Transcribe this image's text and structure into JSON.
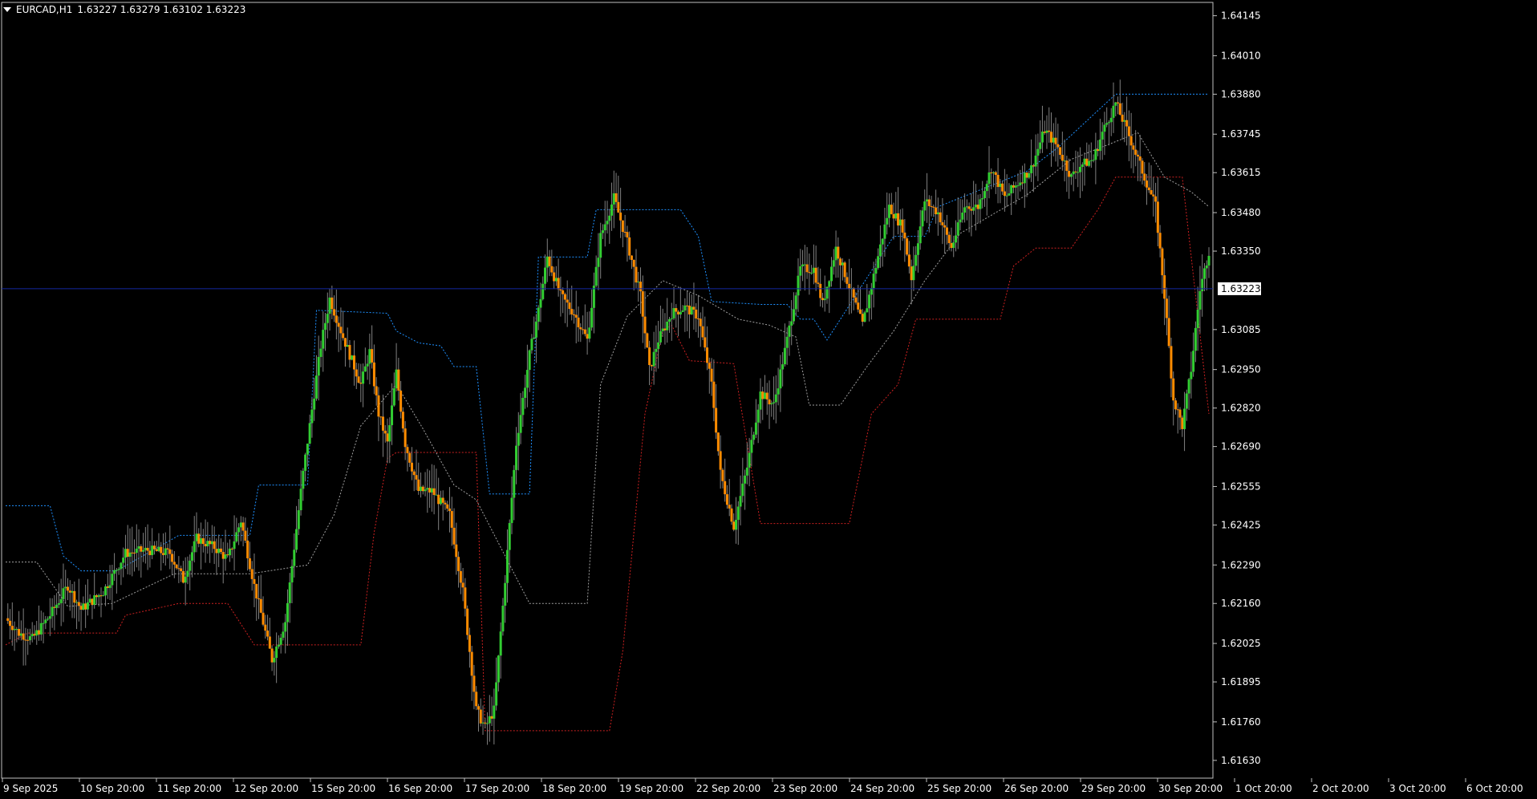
{
  "header": {
    "symbol": "EURCAD,H1",
    "ohlc": "1.63227 1.63279 1.63102 1.63223"
  },
  "colors": {
    "background": "#000000",
    "frame": "#c0c0c0",
    "text": "#ffffff",
    "bull": "#32cd32",
    "bear": "#ff8c00",
    "wick": "#808080",
    "upper_band": "#1e90ff",
    "lower_band": "#cc2020",
    "mid_band": "#a0a0a0",
    "price_line": "#1428a0"
  },
  "chart_data": {
    "type": "line",
    "title": "EURCAD,H1",
    "current_price": 1.63223,
    "current_price_label": "1.63223",
    "ylim": [
      1.6157,
      1.6419
    ],
    "y_ticks": [
      "1.64145",
      "1.64010",
      "1.63880",
      "1.63745",
      "1.63615",
      "1.63480",
      "1.63350",
      "1.63223",
      "1.63085",
      "1.62950",
      "1.62820",
      "1.62690",
      "1.62555",
      "1.62425",
      "1.62290",
      "1.62160",
      "1.62025",
      "1.61895",
      "1.61760",
      "1.61630"
    ],
    "x_ticks": [
      "9 Sep 2025",
      "10 Sep 20:00",
      "11 Sep 20:00",
      "12 Sep 20:00",
      "15 Sep 20:00",
      "16 Sep 20:00",
      "17 Sep 20:00",
      "18 Sep 20:00",
      "19 Sep 20:00",
      "22 Sep 20:00",
      "23 Sep 20:00",
      "24 Sep 20:00",
      "25 Sep 20:00",
      "26 Sep 20:00",
      "29 Sep 20:00",
      "30 Sep 20:00",
      "1 Oct 20:00",
      "2 Oct 20:00",
      "3 Oct 20:00",
      "6 Oct 20:00"
    ],
    "grid": false,
    "series": [
      {
        "values": [
          [
            0,
            1.6211
          ],
          [
            6,
            1.6206
          ],
          [
            12,
            1.6204
          ],
          [
            20,
            1.6212
          ],
          [
            28,
            1.6222
          ],
          [
            34,
            1.6214
          ],
          [
            44,
            1.622
          ],
          [
            54,
            1.6233
          ],
          [
            64,
            1.6234
          ],
          [
            74,
            1.6233
          ],
          [
            80,
            1.6224
          ],
          [
            86,
            1.6238
          ],
          [
            94,
            1.6235
          ],
          [
            100,
            1.6231
          ],
          [
            106,
            1.6244
          ],
          [
            112,
            1.6222
          ],
          [
            120,
            1.6197
          ],
          [
            126,
            1.621
          ],
          [
            134,
            1.626
          ],
          [
            142,
            1.6303
          ],
          [
            146,
            1.6319
          ],
          [
            152,
            1.6306
          ],
          [
            160,
            1.629
          ],
          [
            164,
            1.6301
          ],
          [
            168,
            1.628
          ],
          [
            172,
            1.627
          ],
          [
            176,
            1.6294
          ],
          [
            180,
            1.627
          ],
          [
            186,
            1.6254
          ],
          [
            192,
            1.6254
          ],
          [
            200,
            1.6246
          ],
          [
            206,
            1.622
          ],
          [
            212,
            1.618
          ],
          [
            216,
            1.6174
          ],
          [
            220,
            1.618
          ],
          [
            224,
            1.6215
          ],
          [
            230,
            1.627
          ],
          [
            236,
            1.63
          ],
          [
            240,
            1.6315
          ],
          [
            244,
            1.6333
          ],
          [
            250,
            1.632
          ],
          [
            256,
            1.6314
          ],
          [
            262,
            1.6305
          ],
          [
            268,
            1.634
          ],
          [
            274,
            1.6353
          ],
          [
            280,
            1.6338
          ],
          [
            286,
            1.632
          ],
          [
            290,
            1.6295
          ],
          [
            294,
            1.6305
          ],
          [
            300,
            1.6314
          ],
          [
            306,
            1.6316
          ],
          [
            312,
            1.6313
          ],
          [
            318,
            1.629
          ],
          [
            322,
            1.626
          ],
          [
            328,
            1.6242
          ],
          [
            334,
            1.6262
          ],
          [
            340,
            1.6287
          ],
          [
            346,
            1.6283
          ],
          [
            352,
            1.6305
          ],
          [
            358,
            1.6329
          ],
          [
            364,
            1.6329
          ],
          [
            368,
            1.6317
          ],
          [
            374,
            1.6336
          ],
          [
            380,
            1.6323
          ],
          [
            386,
            1.631
          ],
          [
            392,
            1.633
          ],
          [
            398,
            1.635
          ],
          [
            404,
            1.6343
          ],
          [
            408,
            1.6326
          ],
          [
            414,
            1.6352
          ],
          [
            420,
            1.6348
          ],
          [
            426,
            1.6336
          ],
          [
            432,
            1.635
          ],
          [
            438,
            1.635
          ],
          [
            444,
            1.6363
          ],
          [
            450,
            1.6353
          ],
          [
            456,
            1.6358
          ],
          [
            462,
            1.6363
          ],
          [
            468,
            1.6376
          ],
          [
            474,
            1.637
          ],
          [
            480,
            1.636
          ],
          [
            484,
            1.6364
          ],
          [
            490,
            1.6366
          ],
          [
            494,
            1.6375
          ],
          [
            500,
            1.6385
          ],
          [
            506,
            1.6374
          ],
          [
            512,
            1.6362
          ],
          [
            518,
            1.635
          ],
          [
            522,
            1.632
          ],
          [
            526,
            1.6285
          ],
          [
            530,
            1.6276
          ],
          [
            534,
            1.6295
          ],
          [
            538,
            1.6322
          ],
          [
            542,
            1.6335
          ]
        ]
      },
      {
        "values": [
          [
            0,
            1.6249
          ],
          [
            20,
            1.6249
          ],
          [
            26,
            1.6232
          ],
          [
            34,
            1.6227
          ],
          [
            50,
            1.6227
          ],
          [
            78,
            1.6239
          ],
          [
            110,
            1.6239
          ],
          [
            114,
            1.6256
          ],
          [
            136,
            1.6256
          ],
          [
            140,
            1.6315
          ],
          [
            172,
            1.6314
          ],
          [
            176,
            1.6308
          ],
          [
            186,
            1.6304
          ],
          [
            196,
            1.6303
          ],
          [
            202,
            1.6296
          ],
          [
            212,
            1.6296
          ],
          [
            218,
            1.6253
          ],
          [
            236,
            1.6253
          ],
          [
            240,
            1.6333
          ],
          [
            262,
            1.6333
          ],
          [
            266,
            1.6349
          ],
          [
            304,
            1.6349
          ],
          [
            312,
            1.634
          ],
          [
            318,
            1.6318
          ],
          [
            340,
            1.6317
          ],
          [
            352,
            1.6317
          ],
          [
            358,
            1.6312
          ],
          [
            364,
            1.6312
          ],
          [
            370,
            1.6305
          ],
          [
            400,
            1.634
          ],
          [
            414,
            1.634
          ],
          [
            420,
            1.635
          ],
          [
            460,
            1.6362
          ],
          [
            474,
            1.637
          ],
          [
            500,
            1.6388
          ],
          [
            542,
            1.6388
          ]
        ]
      },
      {
        "values": [
          [
            0,
            1.6202
          ],
          [
            10,
            1.6206
          ],
          [
            50,
            1.6206
          ],
          [
            54,
            1.6212
          ],
          [
            78,
            1.6216
          ],
          [
            100,
            1.6216
          ],
          [
            112,
            1.6202
          ],
          [
            160,
            1.6202
          ],
          [
            166,
            1.624
          ],
          [
            172,
            1.6265
          ],
          [
            176,
            1.6267
          ],
          [
            212,
            1.6267
          ],
          [
            216,
            1.6173
          ],
          [
            272,
            1.6173
          ],
          [
            278,
            1.62
          ],
          [
            288,
            1.628
          ],
          [
            296,
            1.6308
          ],
          [
            300,
            1.631
          ],
          [
            308,
            1.6298
          ],
          [
            328,
            1.6297
          ],
          [
            340,
            1.6243
          ],
          [
            380,
            1.6243
          ],
          [
            390,
            1.628
          ],
          [
            402,
            1.629
          ],
          [
            410,
            1.6312
          ],
          [
            448,
            1.6312
          ],
          [
            454,
            1.633
          ],
          [
            464,
            1.6336
          ],
          [
            480,
            1.6336
          ],
          [
            492,
            1.6349
          ],
          [
            500,
            1.636
          ],
          [
            530,
            1.636
          ],
          [
            542,
            1.628
          ]
        ]
      },
      {
        "values": [
          [
            0,
            1.623
          ],
          [
            14,
            1.623
          ],
          [
            28,
            1.6215
          ],
          [
            48,
            1.6216
          ],
          [
            76,
            1.6226
          ],
          [
            110,
            1.6226
          ],
          [
            136,
            1.6229
          ],
          [
            148,
            1.6246
          ],
          [
            160,
            1.6276
          ],
          [
            176,
            1.629
          ],
          [
            188,
            1.6275
          ],
          [
            202,
            1.6256
          ],
          [
            212,
            1.6251
          ],
          [
            236,
            1.6216
          ],
          [
            262,
            1.6216
          ],
          [
            268,
            1.629
          ],
          [
            280,
            1.6313
          ],
          [
            296,
            1.6325
          ],
          [
            312,
            1.632
          ],
          [
            330,
            1.6312
          ],
          [
            344,
            1.631
          ],
          [
            356,
            1.6306
          ],
          [
            362,
            1.6283
          ],
          [
            376,
            1.6283
          ],
          [
            388,
            1.6296
          ],
          [
            400,
            1.6308
          ],
          [
            414,
            1.6325
          ],
          [
            430,
            1.6341
          ],
          [
            446,
            1.6348
          ],
          [
            460,
            1.6354
          ],
          [
            480,
            1.6366
          ],
          [
            500,
            1.6372
          ],
          [
            510,
            1.6375
          ],
          [
            522,
            1.636
          ],
          [
            534,
            1.6355
          ],
          [
            542,
            1.635
          ]
        ]
      }
    ]
  }
}
